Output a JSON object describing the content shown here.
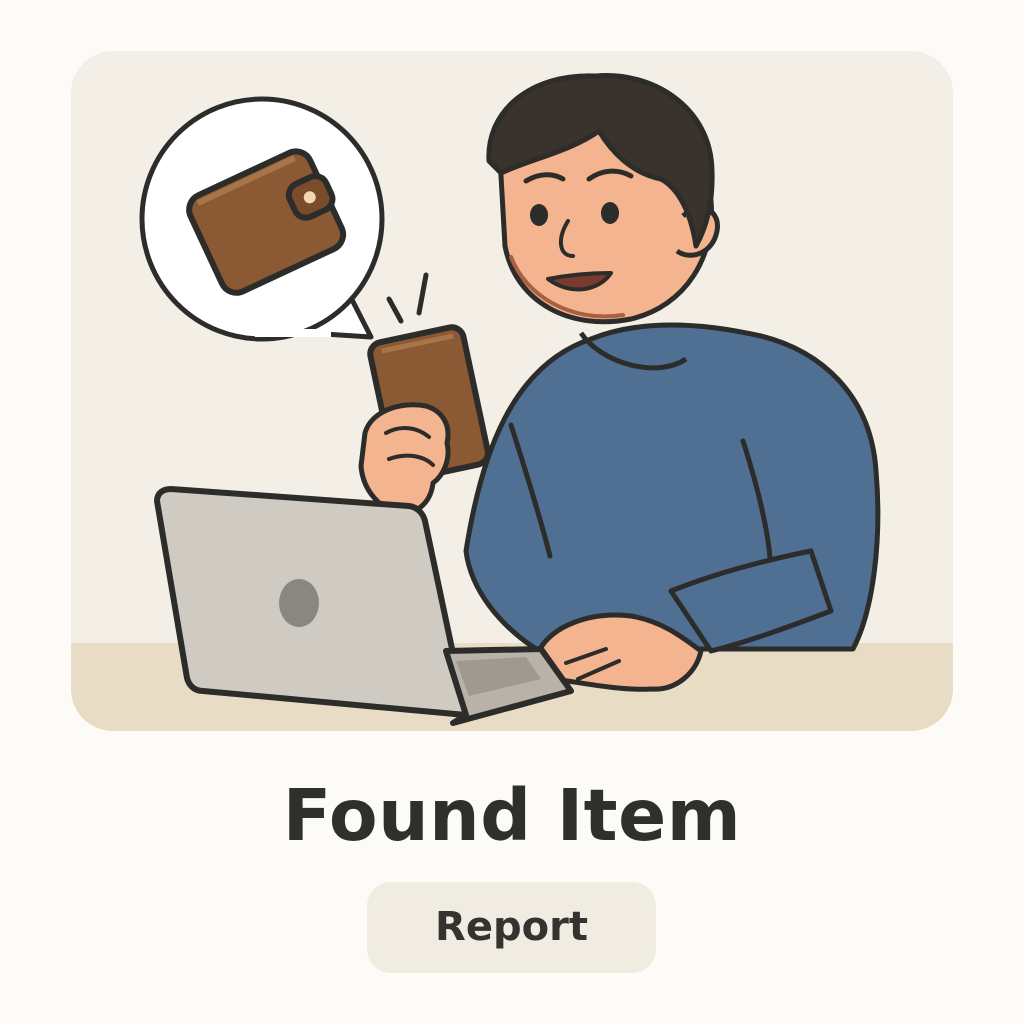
{
  "card": {
    "title": "Found Item",
    "action_label": "Report"
  },
  "illustration": {
    "subject": "person-holding-found-wallet",
    "thought_bubble_icon": "wallet-icon",
    "held_item_icon": "wallet-icon",
    "device": "laptop"
  },
  "colors": {
    "page_background": "#fcfbf7",
    "card_background": "#f4efe6",
    "desk": "#e9dcc5",
    "sweater": "#4f6f93",
    "wallet": "#8b5a34",
    "skin": "#f3b48f",
    "hair": "#3a322c",
    "laptop": "#cfcac2",
    "title_text": "#2f302c",
    "button_background": "#f1ece2"
  }
}
